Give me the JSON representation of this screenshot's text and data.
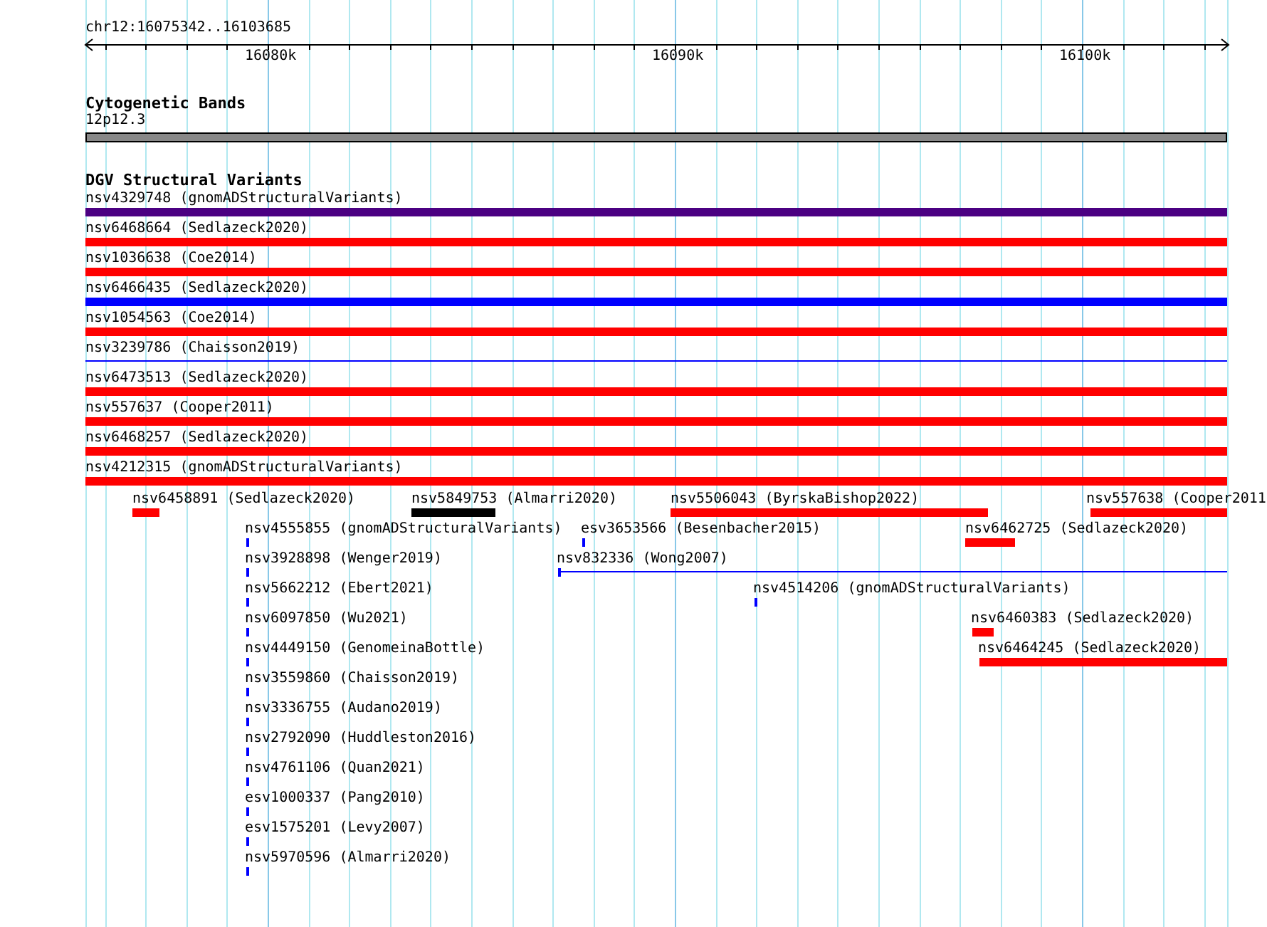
{
  "ruler": {
    "region": "chr12:16075342..16103685",
    "ticks": [
      "16080k",
      "16090k",
      "16100k"
    ]
  },
  "cytogenetic_bands": {
    "title": "Cytogenetic Bands",
    "band": "12p12.3"
  },
  "dgv": {
    "title": "DGV Structural Variants",
    "variants": [
      {
        "label": "nsv4329748 (gnomADStructuralVariants)",
        "color": "#4b0082",
        "kind": "bar"
      },
      {
        "label": "nsv6468664 (Sedlazeck2020)",
        "color": "#ff0000",
        "kind": "bar"
      },
      {
        "label": "nsv1036638 (Coe2014)",
        "color": "#ff0000",
        "kind": "bar"
      },
      {
        "label": "nsv6466435 (Sedlazeck2020)",
        "color": "#0000ff",
        "kind": "bar"
      },
      {
        "label": "nsv1054563 (Coe2014)",
        "color": "#ff0000",
        "kind": "bar"
      },
      {
        "label": "nsv3239786 (Chaisson2019)",
        "color": "#0000ff",
        "kind": "line"
      },
      {
        "label": "nsv6473513 (Sedlazeck2020)",
        "color": "#ff0000",
        "kind": "bar"
      },
      {
        "label": "nsv557637 (Cooper2011)",
        "color": "#ff0000",
        "kind": "bar"
      },
      {
        "label": "nsv6468257 (Sedlazeck2020)",
        "color": "#ff0000",
        "kind": "bar"
      },
      {
        "label": "nsv4212315 (gnomADStructuralVariants)",
        "color": "#ff0000",
        "kind": "bar"
      },
      {
        "label": "nsv6458891 (Sedlazeck2020)",
        "color": "#ff0000",
        "kind": "bar"
      },
      {
        "label": "nsv5849753 (Almarri2020)",
        "color": "#000000",
        "kind": "bar"
      },
      {
        "label": "nsv5506043 (ByrskaBishop2022)",
        "color": "#ff0000",
        "kind": "bar"
      },
      {
        "label": "nsv557638 (Cooper2011",
        "color": "#ff0000",
        "kind": "bar"
      },
      {
        "label": "nsv4555855 (gnomADStructuralVariants)",
        "color": "#0000ff",
        "kind": "bar"
      },
      {
        "label": "esv3653566 (Besenbacher2015)",
        "color": "#0000ff",
        "kind": "bar"
      },
      {
        "label": "nsv6462725 (Sedlazeck2020)",
        "color": "#ff0000",
        "kind": "bar"
      },
      {
        "label": "nsv3928898 (Wenger2019)",
        "color": "#0000ff",
        "kind": "bar"
      },
      {
        "label": "nsv832336 (Wong2007)",
        "color": "#0000ff",
        "kind": "line"
      },
      {
        "label": "nsv5662212 (Ebert2021)",
        "color": "#0000ff",
        "kind": "bar"
      },
      {
        "label": "nsv4514206 (gnomADStructuralVariants)",
        "color": "#0000ff",
        "kind": "bar"
      },
      {
        "label": "nsv6097850 (Wu2021)",
        "color": "#0000ff",
        "kind": "bar"
      },
      {
        "label": "nsv6460383 (Sedlazeck2020)",
        "color": "#ff0000",
        "kind": "bar"
      },
      {
        "label": "nsv4449150 (GenomeinaBottle)",
        "color": "#0000ff",
        "kind": "bar"
      },
      {
        "label": "nsv6464245 (Sedlazeck2020)",
        "color": "#ff0000",
        "kind": "bar"
      },
      {
        "label": "nsv3559860 (Chaisson2019)",
        "color": "#0000ff",
        "kind": "bar"
      },
      {
        "label": "nsv3336755 (Audano2019)",
        "color": "#0000ff",
        "kind": "bar"
      },
      {
        "label": "nsv2792090 (Huddleston2016)",
        "color": "#0000ff",
        "kind": "bar"
      },
      {
        "label": "nsv4761106 (Quan2021)",
        "color": "#0000ff",
        "kind": "bar"
      },
      {
        "label": "esv1000337 (Pang2010)",
        "color": "#0000ff",
        "kind": "bar"
      },
      {
        "label": "esv1575201 (Levy2007)",
        "color": "#0000ff",
        "kind": "bar"
      },
      {
        "label": "nsv5970596 (Almarri2020)",
        "color": "#0000ff",
        "kind": "bar"
      }
    ]
  }
}
